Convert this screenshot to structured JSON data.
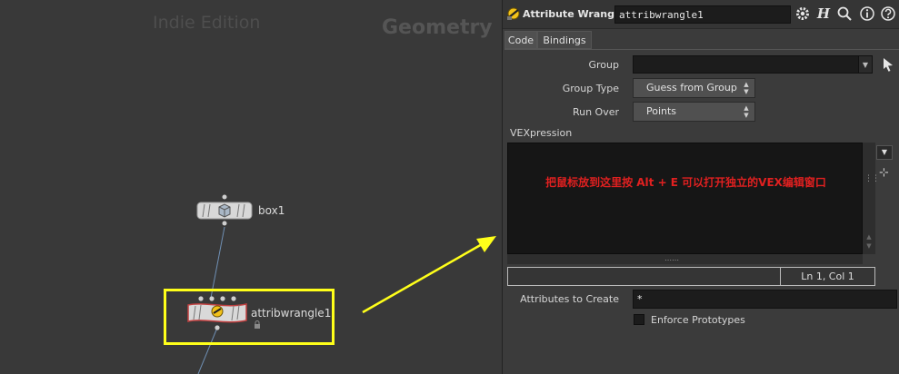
{
  "network": {
    "edition": "Indie Edition",
    "context": "Geometry",
    "nodes": [
      {
        "label": "box1"
      },
      {
        "label": "attribwrangle1"
      }
    ]
  },
  "pane": {
    "op_type": "Attribute Wrangle",
    "node_name": "attribwrangle1",
    "tabs": [
      "Code",
      "Bindings"
    ],
    "params": {
      "group_label": "Group",
      "group_value": "",
      "group_type_label": "Group Type",
      "group_type_value": "Guess from Group",
      "run_over_label": "Run Over",
      "run_over_value": "Points",
      "vex_label": "VEXpression",
      "attributes_label": "Attributes to Create",
      "attributes_value": "*",
      "enforce_label": "Enforce Prototypes",
      "enforce_checked": false
    },
    "editor": {
      "hint": "把鼠标放到这里按 Alt + E 可以打开独立的VEX编辑窗口",
      "cursor_pos": "Ln 1, Col 1"
    }
  },
  "colors": {
    "highlight": "#ffff1a",
    "arrow": "#ffff1a",
    "hint": "#e02020",
    "wire": "#6f8fb3"
  },
  "icons": [
    "wrangle-icon",
    "gear-icon",
    "help-h-icon",
    "search-icon",
    "info-icon",
    "question-icon",
    "pick-arrow-icon",
    "box-node-icon",
    "lock-icon"
  ]
}
